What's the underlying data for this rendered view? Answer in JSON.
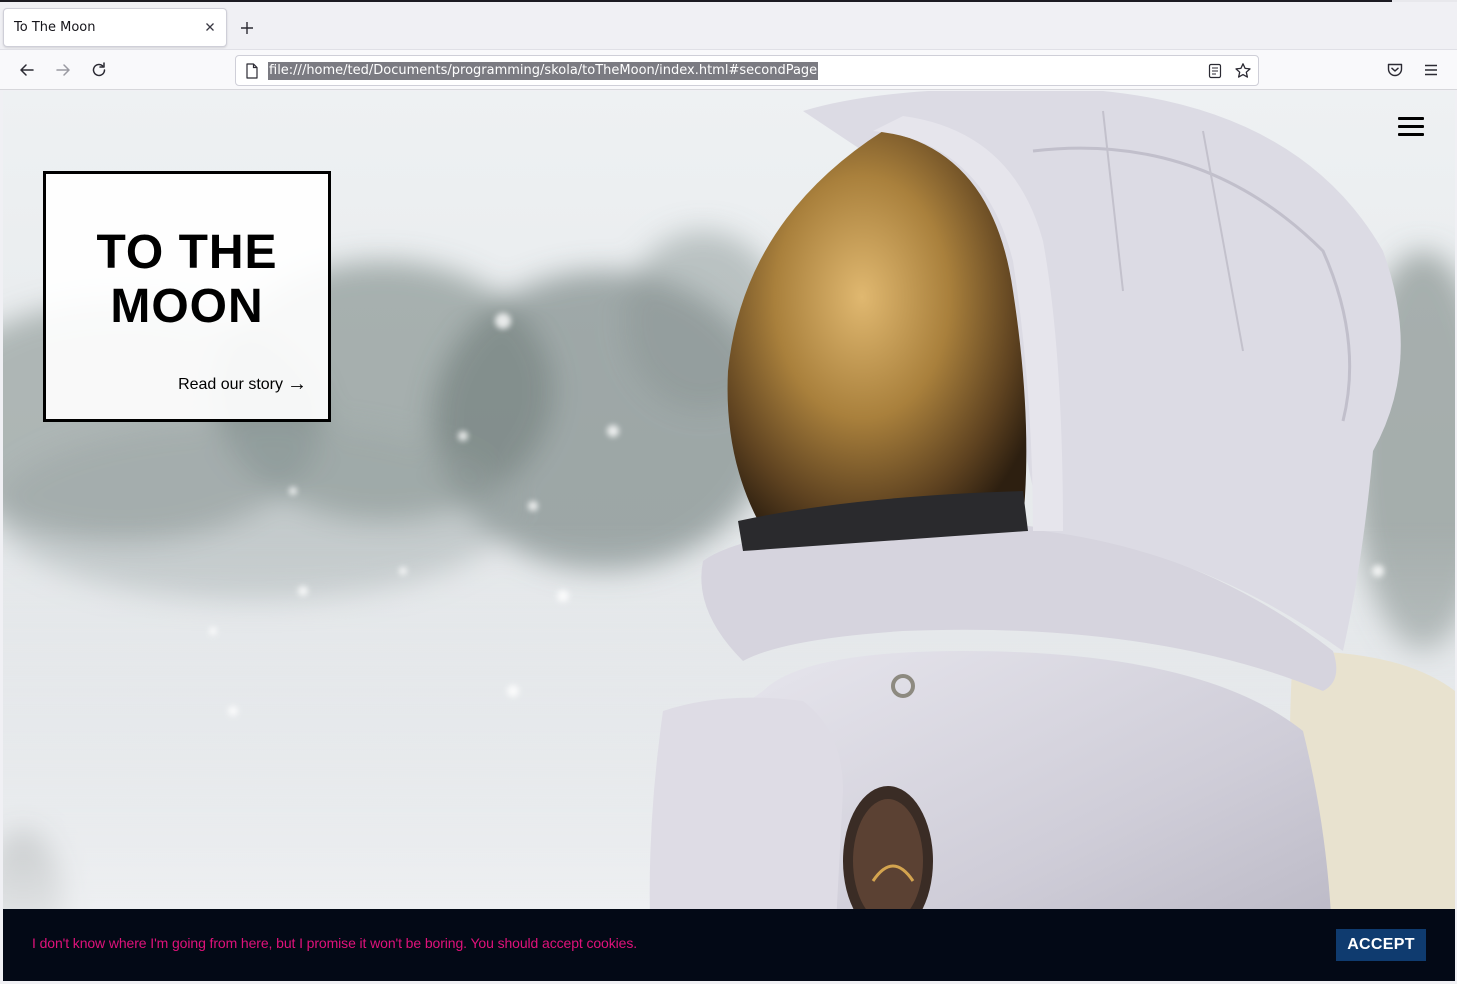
{
  "browser": {
    "tab_title": "To The Moon",
    "url": "file:///home/ted/Documents/programming/skola/toTheMoon/index.html#secondPage"
  },
  "page": {
    "title": "TO THE MOON",
    "story_link": "Read our story",
    "story_arrow": "→"
  },
  "cookie": {
    "message": "I don't know where I'm going from here, but I promise it won't be boring. You should accept cookies.",
    "accept_label": "ACCEPT"
  },
  "colors": {
    "cookie_bar_bg": "#030916",
    "cookie_text": "#e0127b",
    "accept_bg": "#0f3b6f"
  },
  "icons": [
    "close-icon",
    "plus-icon",
    "back-arrow-icon",
    "forward-arrow-icon",
    "reload-icon",
    "page-icon",
    "reader-view-icon",
    "star-icon",
    "pocket-icon",
    "app-menu-icon",
    "hamburger-menu-icon",
    "right-arrow-icon"
  ]
}
